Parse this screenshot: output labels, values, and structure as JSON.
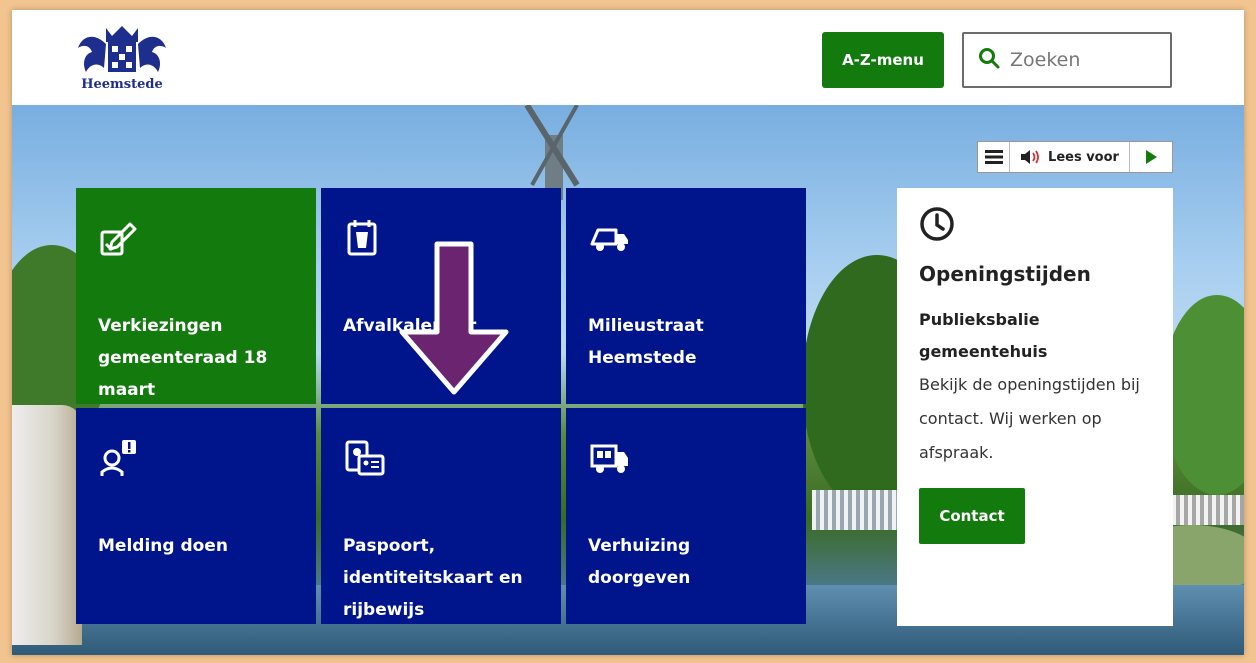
{
  "header": {
    "logo_text": "Heemstede",
    "az_menu_label": "A-Z-menu",
    "search_placeholder": "Zoeken"
  },
  "readspeaker": {
    "label": "Lees voor"
  },
  "tiles": [
    {
      "label": "Verkiezingen gemeenteraad 18 maart",
      "icon": "ballot-pen-icon",
      "color": "#137a0d"
    },
    {
      "label": "Afvalkalender",
      "icon": "waste-calendar-icon",
      "color": "#00148c"
    },
    {
      "label": "Milieustraat Heemstede",
      "icon": "truck-icon",
      "color": "#00148c"
    },
    {
      "label": "Melding doen",
      "icon": "person-report-icon",
      "color": "#00148c"
    },
    {
      "label": "Paspoort, identiteitskaart en rijbewijs",
      "icon": "id-card-icon",
      "color": "#00148c"
    },
    {
      "label": "Verhuizing doorgeven",
      "icon": "moving-truck-icon",
      "color": "#00148c"
    }
  ],
  "opening_hours": {
    "title": "Openingstijden",
    "subtitle": "Publieksbalie gemeentehuis",
    "text": "Bekijk de openingstijden bij contact. Wij werken op afspraak.",
    "button_label": "Contact"
  },
  "colors": {
    "brand_green": "#137a0d",
    "brand_blue": "#00148c",
    "annotation_arrow": "#6b2470",
    "frame": "#f2c48f"
  }
}
